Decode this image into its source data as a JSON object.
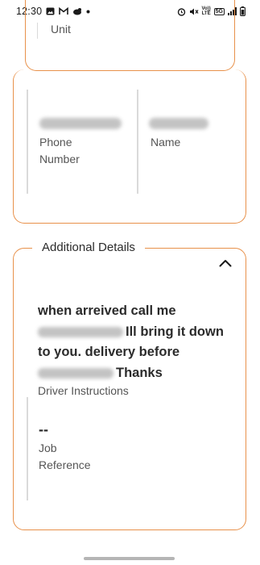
{
  "status_bar": {
    "time": "12:30",
    "left_icons": [
      "image-icon",
      "gmail-icon",
      "bird-icon",
      "dot-icon"
    ],
    "right_icons": [
      "alarm-icon",
      "mute-icon",
      "volte-icon",
      "5g-icon",
      "signal-icon",
      "battery-icon"
    ],
    "volte_text": "Vo)) LTE",
    "net_text": "5G"
  },
  "unit_card": {
    "label": "Unit"
  },
  "contact_card": {
    "phone_label": "Phone\nNumber",
    "name_label": "Name"
  },
  "details_card": {
    "title": "Additional Details",
    "instructions_part1": "when arreived call me",
    "instructions_part2": "Ill bring it down to you. delivery before",
    "instructions_part3": "Thanks",
    "instructions_label": "Driver Instructions",
    "job_value": "--",
    "job_label": "Job\nReference"
  },
  "colors": {
    "accent": "#e8914b",
    "divider": "#dadada"
  }
}
